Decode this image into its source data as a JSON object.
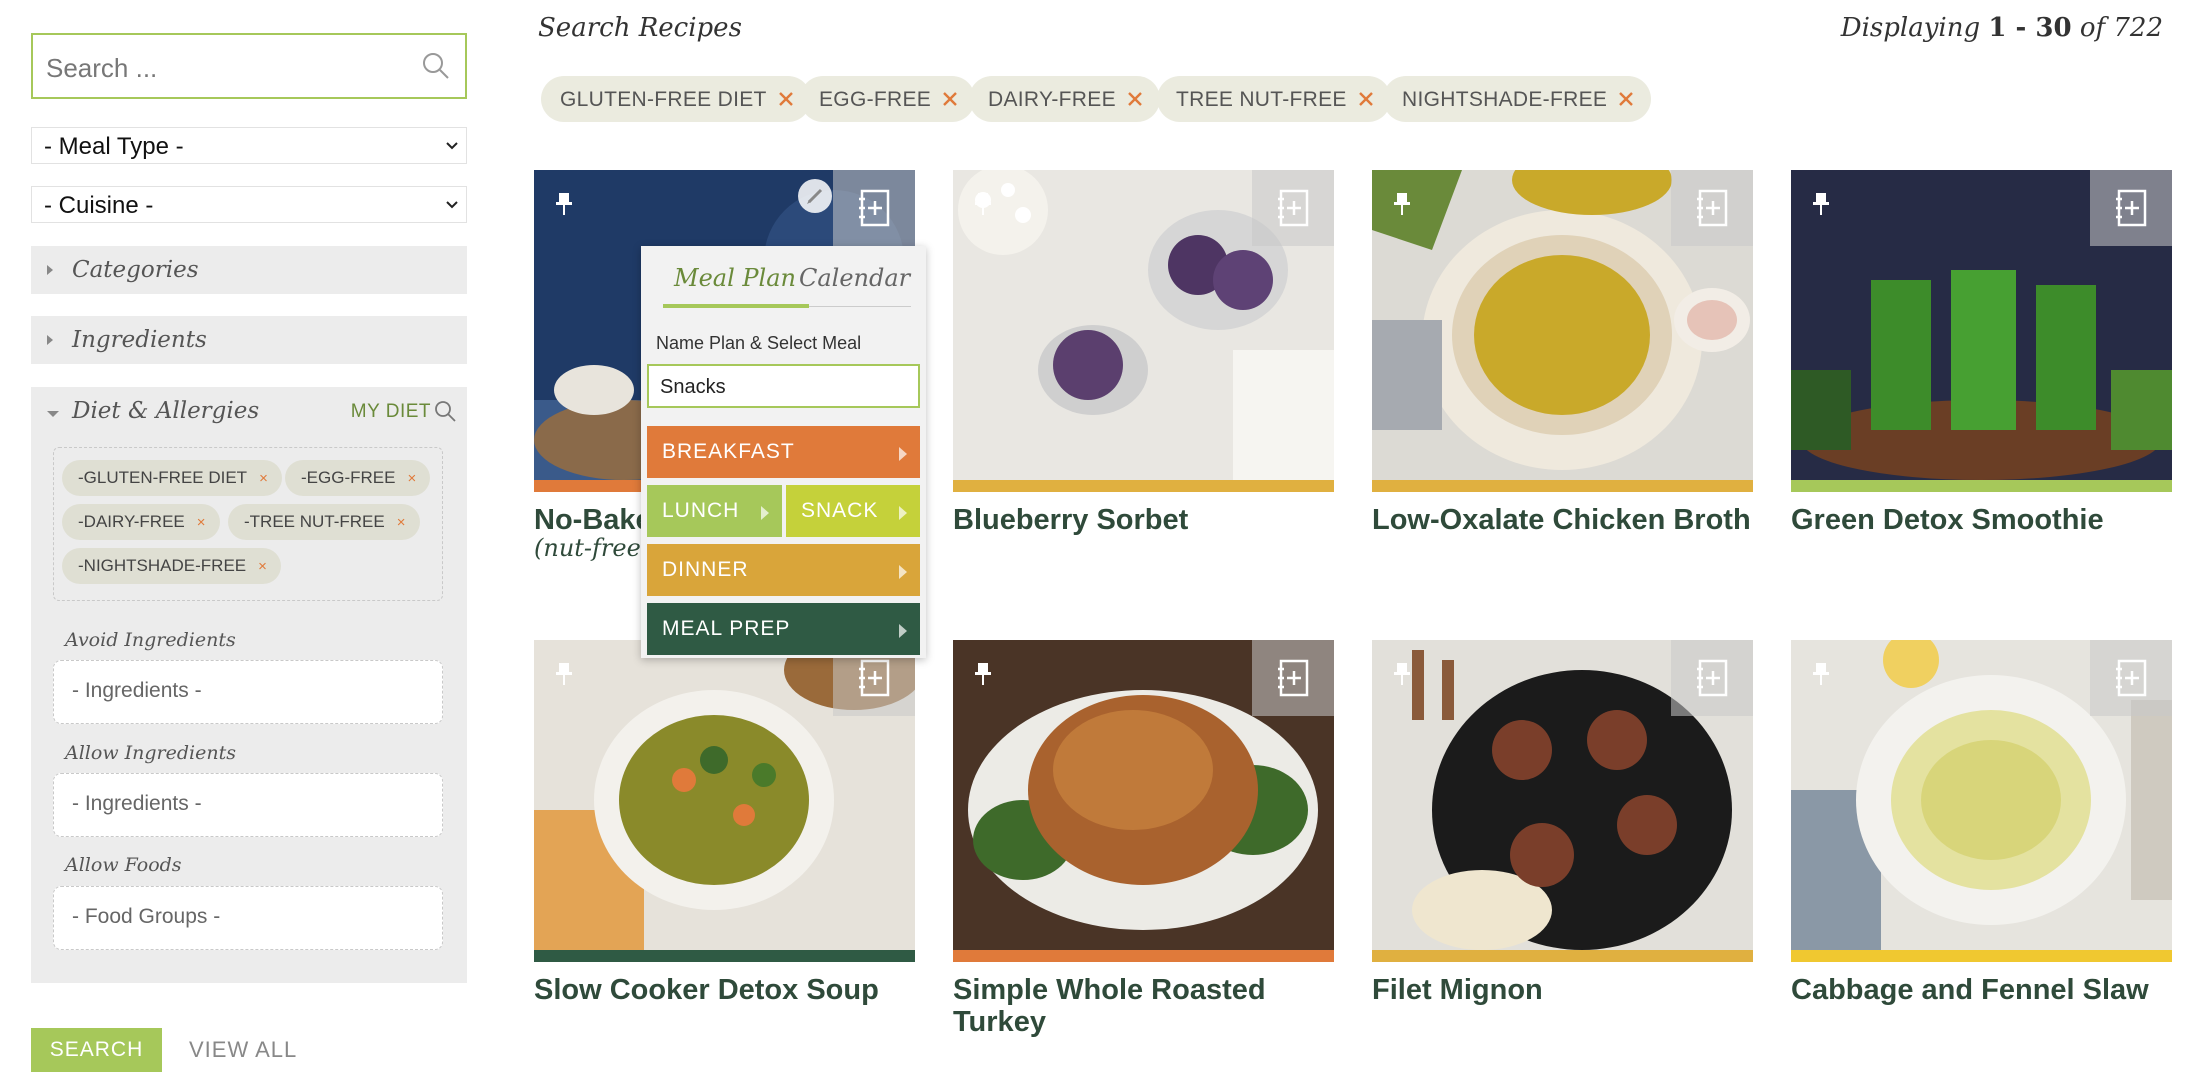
{
  "sidebar": {
    "search_placeholder": "Search ...",
    "meal_type": "- Meal Type -",
    "cuisine": "- Cuisine -",
    "categories": "Categories",
    "ingredients": "Ingredients",
    "diet_title": "Diet & Allergies",
    "my_diet": "MY DIET",
    "diet_tags": [
      "-GLUTEN-FREE DIET",
      "-EGG-FREE",
      "-DAIRY-FREE",
      "-TREE NUT-FREE",
      "-NIGHTSHADE-FREE"
    ],
    "remove_glyph": "×",
    "avoid_label": "Avoid Ingredients",
    "avoid_placeholder": "- Ingredients -",
    "allow_label": "Allow Ingredients",
    "allow_placeholder": "- Ingredients -",
    "foods_label": "Allow Foods",
    "foods_placeholder": "- Food Groups -",
    "search_button": "SEARCH",
    "view_all": "VIEW ALL"
  },
  "header": {
    "title": "Search Recipes",
    "displaying_prefix": "Displaying",
    "range": "1 - 30",
    "of": "of",
    "total": "722"
  },
  "filter_tags": [
    "GLUTEN-FREE DIET",
    "EGG-FREE",
    "DAIRY-FREE",
    "TREE NUT-FREE",
    "NIGHTSHADE-FREE"
  ],
  "recipes": [
    {
      "title": "No-Bake",
      "subtitle": "(nut-free +",
      "stripe": "#e07a3a"
    },
    {
      "title": "Blueberry Sorbet",
      "stripe": "#e0b040"
    },
    {
      "title": "Low-Oxalate Chicken Broth",
      "stripe": "#e0b040"
    },
    {
      "title": "Green Detox Smoothie",
      "stripe": "#a6c85a"
    },
    {
      "title": "Slow Cooker Detox Soup",
      "stripe": "#2f5a44"
    },
    {
      "title": "Simple Whole Roasted Turkey",
      "stripe": "#e07a3a"
    },
    {
      "title": "Filet Mignon",
      "stripe": "#e0b040"
    },
    {
      "title": "Cabbage and Fennel Slaw",
      "stripe": "#f0c830"
    }
  ],
  "popup": {
    "tab_meal_plan": "Meal Plan",
    "tab_calendar": "Calendar",
    "name_label": "Name Plan & Select Meal",
    "name_value": "Snacks",
    "breakfast": "BREAKFAST",
    "lunch": "LUNCH",
    "snack": "SNACK",
    "dinner": "DINNER",
    "meal_prep": "MEAL PREP"
  },
  "colors": {
    "accent_green": "#a6c85a",
    "orange": "#e07a3a",
    "lime": "#c5d13a",
    "mustard": "#d9a53a",
    "dark_green": "#2f5a44",
    "title_green": "#2f4a3a"
  }
}
